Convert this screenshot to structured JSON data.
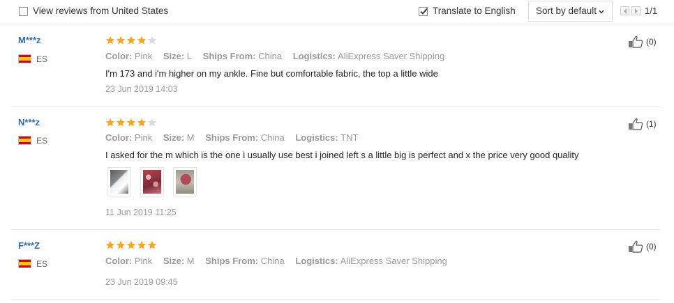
{
  "toolbar": {
    "us_reviews_label": "View reviews from United States",
    "us_reviews_checked": false,
    "translate_label": "Translate to English",
    "translate_checked": true,
    "sort_label": "Sort by default",
    "pagination": "1/1"
  },
  "reviews": [
    {
      "user": "M***z",
      "country": "ES",
      "rating": 4,
      "color_label": "Color:",
      "color": "Pink",
      "size_label": "Size:",
      "size": "L",
      "ships_label": "Ships From:",
      "ships": "China",
      "logistics_label": "Logistics:",
      "logistics": "AliExpress Saver Shipping",
      "text": "I'm 173 and i'm higher on my ankle. Fine but comfortable fabric, the top a little wide",
      "date": "23 Jun 2019 14:03",
      "helpful": "(0)",
      "photos": []
    },
    {
      "user": "N***z",
      "country": "ES",
      "rating": 4,
      "color_label": "Color:",
      "color": "Pink",
      "size_label": "Size:",
      "size": "M",
      "ships_label": "Ships From:",
      "ships": "China",
      "logistics_label": "Logistics:",
      "logistics": "TNT",
      "text": "I asked for the m which is the one i usually use best i joined left s a little big is perfect and x the price very good quality",
      "date": "11 Jun 2019 11:25",
      "helpful": "(1)",
      "photos": [
        "photo-1",
        "photo-2",
        "photo-3"
      ]
    },
    {
      "user": "F***Z",
      "country": "ES",
      "rating": 5,
      "color_label": "Color:",
      "color": "Pink",
      "size_label": "Size:",
      "size": "M",
      "ships_label": "Ships From:",
      "ships": "China",
      "logistics_label": "Logistics:",
      "logistics": "AliExpress Saver Shipping",
      "text": "",
      "date": "23 Jun 2019 09:45",
      "helpful": "(0)",
      "photos": []
    }
  ],
  "colors": {
    "star_on": "#f5a623",
    "star_off": "#d9d9d9",
    "username": "#2e6ab3"
  }
}
